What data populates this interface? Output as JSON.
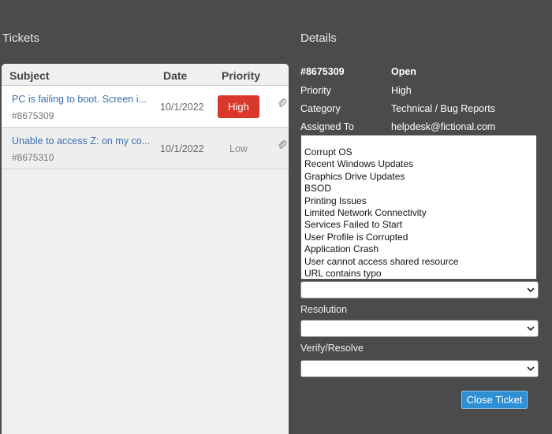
{
  "tickets": {
    "title": "Tickets",
    "headers": {
      "subject": "Subject",
      "date": "Date",
      "priority": "Priority"
    },
    "rows": [
      {
        "subject": "PC is failing to boot. Screen i...",
        "id": "#8675309",
        "date": "10/1/2022",
        "priority": "High"
      },
      {
        "subject": "Unable to access Z: on my co...",
        "id": "#8675310",
        "date": "10/1/2022",
        "priority": "Low"
      }
    ]
  },
  "details": {
    "title": "Details",
    "ticket_id": "#8675309",
    "status": "Open",
    "priority_label": "Priority",
    "priority_value": "High",
    "category_label": "Category",
    "category_value": "Technical / Bug Reports",
    "assigned_label": "Assigned To",
    "assigned_value": "helpdesk@fictional.com",
    "issues": [
      "Corrupt OS",
      "Recent Windows Updates",
      "Graphics Drive Updates",
      "BSOD",
      "Printing Issues",
      "Limited Network Connectivity",
      "Services Failed to Start",
      "User Profile is Corrupted",
      "Application Crash",
      "User cannot access shared resource",
      "URL contains typo"
    ],
    "resolution_label": "Resolution",
    "verify_label": "Verify/Resolve",
    "close_button": "Close Ticket"
  },
  "colors": {
    "background": "#4b4b4b",
    "high_priority": "#d9382a",
    "button": "#2f8fd4",
    "link": "#3d6fb0"
  }
}
